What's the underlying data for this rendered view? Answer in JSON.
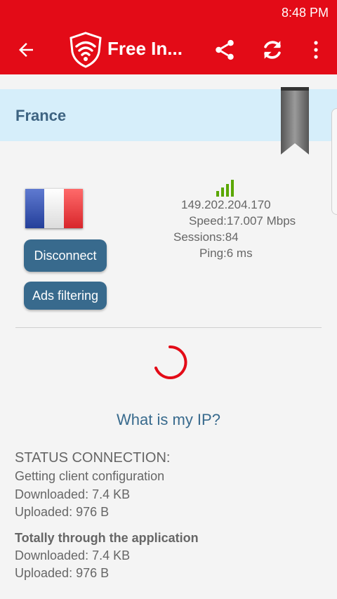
{
  "status_bar": {
    "time": "8:48 PM"
  },
  "app_bar": {
    "title": "Free In...",
    "accent": "#e30b17"
  },
  "server": {
    "country": "France",
    "ip": "149.202.204.170",
    "speed": "Speed:17.007 Mbps",
    "sessions": "Sessions:84",
    "ping": "Ping:6 ms"
  },
  "buttons": {
    "disconnect": "Disconnect",
    "ads_filtering": "Ads filtering"
  },
  "links": {
    "what_is_my_ip": "What is my IP?"
  },
  "status": {
    "heading": "STATUS CONNECTION:",
    "state": "Getting client configuration",
    "downloaded": "Downloaded: 7.4 KB",
    "uploaded": "Uploaded: 976 B"
  },
  "totals": {
    "heading": "Totally through the application",
    "downloaded": "Downloaded: 7.4 KB",
    "uploaded": "Uploaded: 976 B"
  },
  "icons": [
    "back-arrow-icon",
    "wifi-shield-logo-icon",
    "share-icon",
    "refresh-icon",
    "more-vert-icon",
    "signal-bars-icon",
    "bookmark-icon",
    "loading-spinner-icon"
  ]
}
